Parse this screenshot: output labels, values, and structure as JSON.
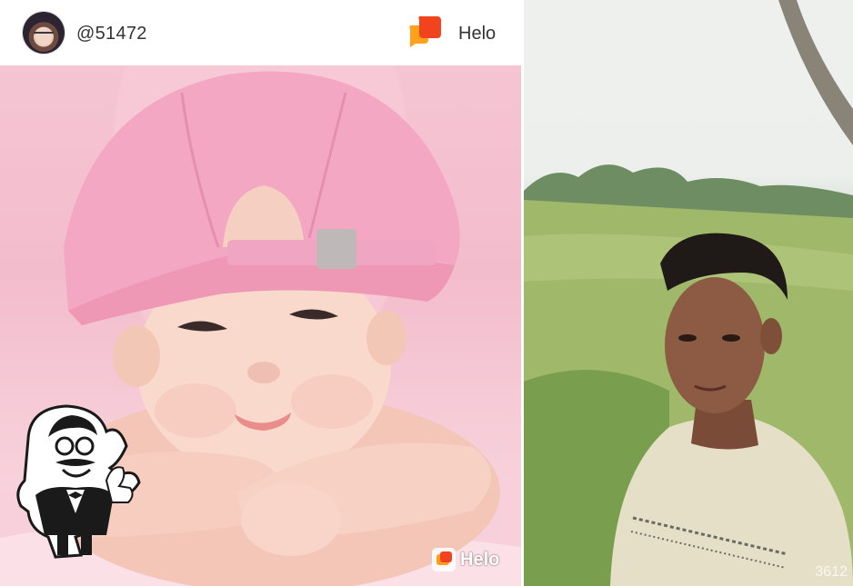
{
  "header": {
    "username": "@51472",
    "brand_name": "Helo"
  },
  "photos": [
    {
      "name": "baby-photo",
      "watermark": "Helo"
    },
    {
      "name": "selfie-photo",
      "stamp": "3612"
    }
  ],
  "icons": {
    "avatar": "profile-avatar",
    "brand": "helo-chat-bubbles-icon",
    "badge": "chef-waiter-logo"
  },
  "colors": {
    "brand_orange": "#ff6a1a",
    "brand_red": "#f23c1f",
    "text": "#333333"
  }
}
